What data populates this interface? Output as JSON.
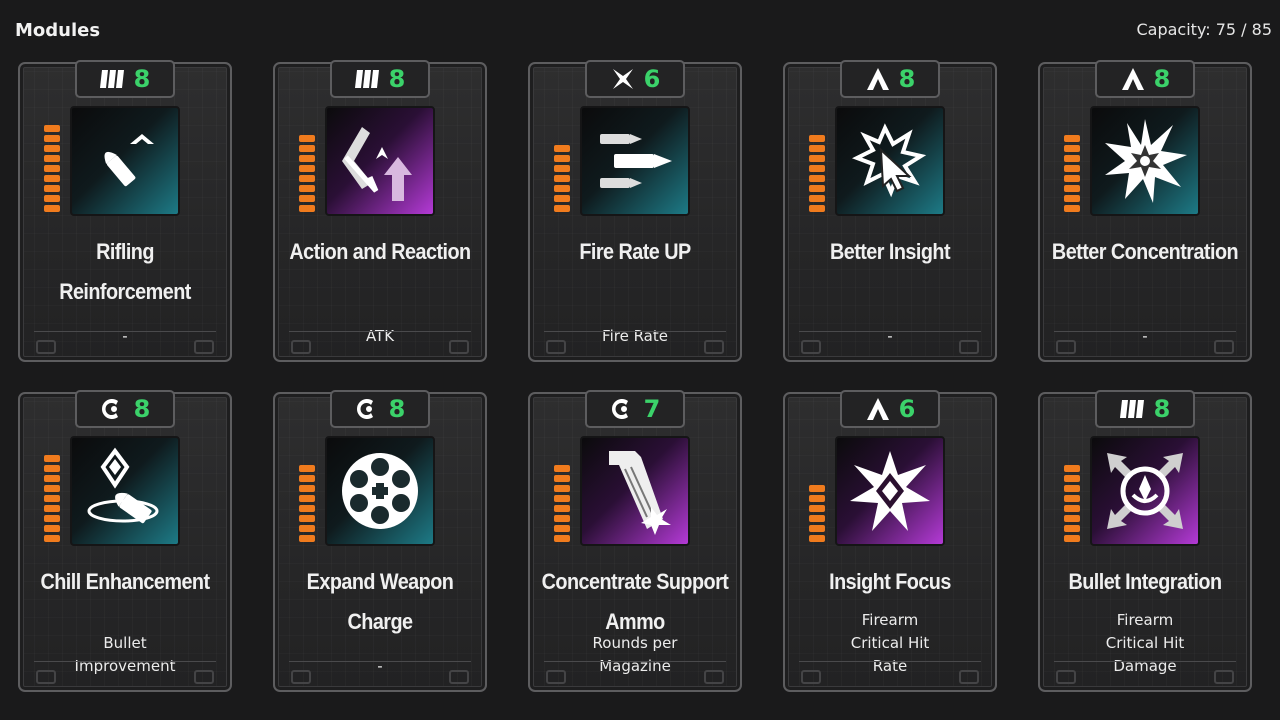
{
  "header": {
    "title": "Modules",
    "capacity": "Capacity: 75 / 85"
  },
  "colors": {
    "cost": "#3bd26a",
    "pip": "#f07b1d",
    "teal": "#1d7a86",
    "purple": "#b43ad6"
  },
  "modules": [
    {
      "name_lines": [
        "Rifling Reinforcement"
      ],
      "cost": "8",
      "socket": "bars-socket-icon",
      "pips": 9,
      "art": "bullet-chevron-icon",
      "tint": "teal",
      "effect_lines": [
        "-"
      ]
    },
    {
      "name_lines": [
        "Action and Reaction"
      ],
      "cost": "8",
      "socket": "bars-socket-icon",
      "pips": 8,
      "art": "arrow-rebound-icon",
      "tint": "purple",
      "effect_lines": [
        "ATK"
      ]
    },
    {
      "name_lines": [
        "Fire Rate UP"
      ],
      "cost": "6",
      "socket": "cross-socket-icon",
      "pips": 7,
      "art": "triple-bullets-icon",
      "tint": "teal",
      "effect_lines": [
        "Fire Rate"
      ]
    },
    {
      "name_lines": [
        "Better Insight"
      ],
      "cost": "8",
      "socket": "chevron-socket-icon",
      "pips": 8,
      "art": "cursor-burst-icon",
      "tint": "teal",
      "effect_lines": [
        "-"
      ]
    },
    {
      "name_lines": [
        "Better Concentration"
      ],
      "cost": "8",
      "socket": "chevron-socket-icon",
      "pips": 8,
      "art": "starburst-icon",
      "tint": "teal",
      "effect_lines": [
        "-"
      ]
    },
    {
      "name_lines": [
        "Chill Enhancement"
      ],
      "cost": "8",
      "socket": "crescent-socket-icon",
      "pips": 9,
      "art": "ice-bullet-icon",
      "tint": "teal",
      "effect_lines": [
        "Bullet",
        "Improvement"
      ]
    },
    {
      "name_lines": [
        "Expand Weapon",
        "Charge"
      ],
      "cost": "8",
      "socket": "crescent-socket-icon",
      "pips": 8,
      "art": "revolver-cylinder-icon",
      "tint": "teal",
      "effect_lines": [
        "-"
      ]
    },
    {
      "name_lines": [
        "Concentrate Support",
        "Ammo"
      ],
      "cost": "7",
      "socket": "crescent-socket-icon",
      "pips": 8,
      "art": "magazine-icon",
      "tint": "purple",
      "effect_lines": [
        "Rounds per",
        "Magazine"
      ]
    },
    {
      "name_lines": [
        "Insight Focus"
      ],
      "cost": "6",
      "socket": "chevron-socket-icon",
      "pips": 6,
      "art": "diamond-burst-icon",
      "tint": "purple",
      "effect_lines": [
        "Firearm",
        "Critical Hit",
        "Rate"
      ]
    },
    {
      "name_lines": [
        "Bullet Integration"
      ],
      "cost": "8",
      "socket": "bars-socket-icon",
      "pips": 8,
      "art": "converge-arrows-icon",
      "tint": "purple",
      "effect_lines": [
        "Firearm",
        "Critical Hit",
        "Damage"
      ]
    }
  ]
}
